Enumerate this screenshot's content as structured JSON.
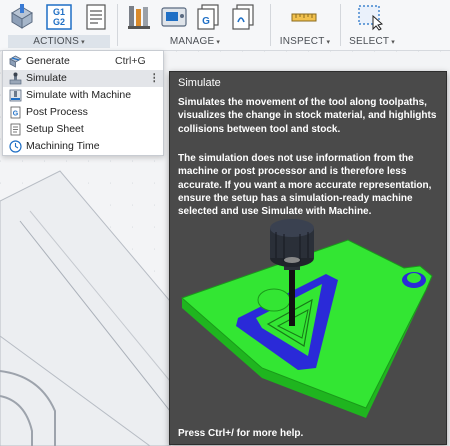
{
  "ribbon": {
    "groups": [
      {
        "label": "ACTIONS",
        "caret": "▾"
      },
      {
        "label": "MANAGE",
        "caret": "▾"
      },
      {
        "label": "INSPECT",
        "caret": "▾"
      },
      {
        "label": "SELECT",
        "caret": "▾"
      }
    ],
    "tools": {
      "actions": [
        "stock-icon",
        "g1g2-icon",
        "setup-sheet-icon"
      ],
      "manage": [
        "tool-library-icon",
        "machine-library-icon",
        "template-icon",
        "post-library-icon"
      ],
      "inspect": [
        "measure-icon"
      ],
      "select": [
        "select-box-icon"
      ]
    },
    "g1g2_text": [
      "G1",
      "G2"
    ]
  },
  "menu": {
    "items": [
      {
        "label": "Generate",
        "shortcut": "Ctrl+G",
        "icon": "generate-icon"
      },
      {
        "label": "Simulate",
        "shortcut": "",
        "icon": "simulate-icon",
        "more": "⋮",
        "highlighted": true
      },
      {
        "label": "Simulate with Machine",
        "shortcut": "",
        "icon": "simulate-machine-icon"
      },
      {
        "label": "Post Process",
        "shortcut": "",
        "icon": "post-process-icon"
      },
      {
        "label": "Setup Sheet",
        "shortcut": "",
        "icon": "setup-sheet-icon"
      },
      {
        "label": "Machining Time",
        "shortcut": "",
        "icon": "clock-icon"
      }
    ]
  },
  "tooltip": {
    "title": "Simulate",
    "description": "Simulates the movement of the tool along toolpaths, visualizes the change in stock material, and highlights collisions between tool and stock.",
    "note": "The simulation does not use information from the machine or post processor and is therefore less accurate. If you want a more accurate representation, ensure the setup has a simulation-ready machine selected and use Simulate with Machine.",
    "footer": "Press Ctrl+/ for more help."
  },
  "colors": {
    "stock_green": "#2ee12e",
    "toolpath_blue": "#2a2ad8",
    "tooltip_bg": "#4a4a4a",
    "accent_blue": "#1f6fc5"
  }
}
